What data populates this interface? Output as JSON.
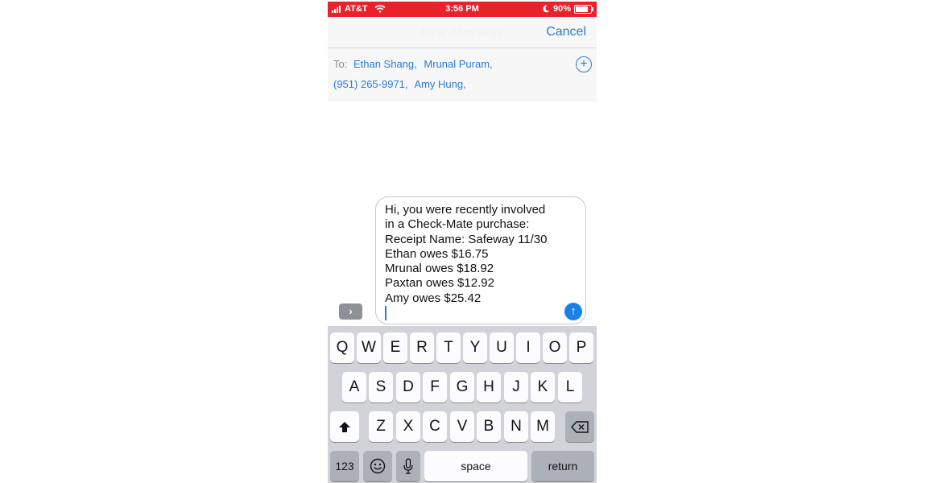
{
  "status_bar": {
    "carrier": "AT&T",
    "time": "3:56 PM",
    "battery": "90%",
    "battery_level": 0.9
  },
  "nav": {
    "title": "New iMessage",
    "cancel_label": "Cancel"
  },
  "recipients": {
    "to_label": "To:",
    "line1": [
      "Ethan Shang,",
      "Mrunal Puram,"
    ],
    "line2": [
      "(951) 265-9971,",
      "Amy Hung,"
    ]
  },
  "message": {
    "lines": [
      "Hi, you were recently involved",
      "in a Check-Mate purchase:",
      "Receipt Name: Safeway 11/30",
      "Ethan owes $16.75",
      "Mrunal owes $18.92",
      "Paxtan owes $12.92",
      "Amy owes $25.42"
    ]
  },
  "icons": {
    "expand": "chevron-right-icon",
    "add_recipient": "plus-circle-icon",
    "send": "arrow-up-icon",
    "shift": "shift-icon",
    "backspace": "backspace-icon",
    "emoji": "emoji-icon",
    "dictation": "microphone-icon"
  },
  "keyboard": {
    "row1": [
      "Q",
      "W",
      "E",
      "R",
      "T",
      "Y",
      "U",
      "I",
      "O",
      "P"
    ],
    "row2": [
      "A",
      "S",
      "D",
      "F",
      "G",
      "H",
      "J",
      "K",
      "L"
    ],
    "row3": [
      "Z",
      "X",
      "C",
      "V",
      "B",
      "N",
      "M"
    ],
    "numbers_label": "123",
    "space_label": "space",
    "return_label": "return"
  },
  "colors": {
    "accent": "#2a7ad6",
    "status_bar": "#e8222b",
    "send": "#1a80e5"
  }
}
